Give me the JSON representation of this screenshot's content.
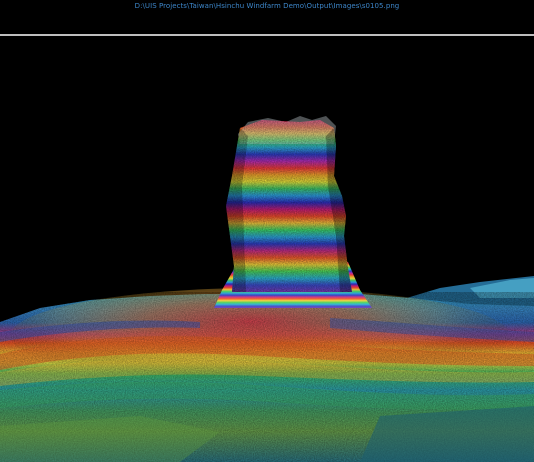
{
  "window": {
    "title": "D:\\UIS Projects\\Taiwan\\Hsinchu Windfarm Demo\\Output\\Images\\s0105.png"
  },
  "scene": {
    "description_icon": "sonar-3d-render-icon",
    "background_color": "#000000",
    "title_color": "#3d86c9",
    "divider_color": "#bdbdbd"
  }
}
